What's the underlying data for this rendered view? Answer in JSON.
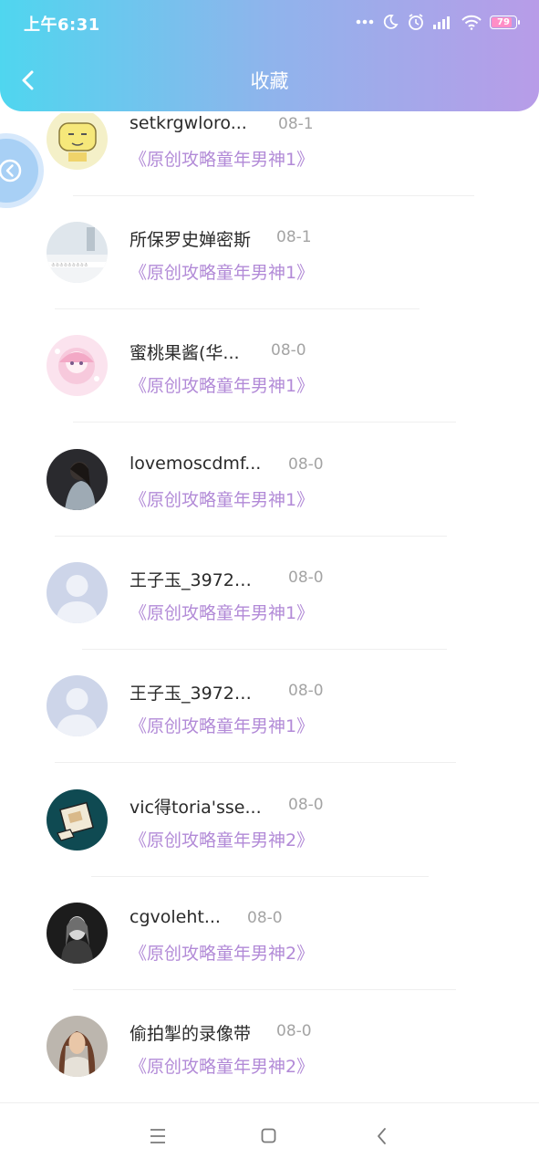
{
  "status_bar": {
    "time": "上午6:31",
    "battery": "79",
    "icons": [
      "more-dots-icon",
      "moon-icon",
      "alarm-icon",
      "signal-icon",
      "wifi-icon",
      "battery-icon"
    ]
  },
  "header": {
    "title": "收藏",
    "back_icon": "chevron-left-icon",
    "gradient_colors": [
      "#4fd6ef",
      "#8fb4ec",
      "#b89ce8"
    ]
  },
  "floating_button": {
    "icon": "chevron-left-circle-icon"
  },
  "colors": {
    "link": "#b28ad7",
    "date": "#a4a4a4",
    "name": "#2a2a2a"
  },
  "items": [
    {
      "name": "setkrgwloro...",
      "date": "08-1",
      "link": "《原创攻略童年男神1》",
      "avatar": "cartoon-face"
    },
    {
      "name": "所保罗史婵密斯",
      "date": "08-1",
      "link": "《原创攻略童年男神1》",
      "avatar": "snow-scene"
    },
    {
      "name": "蜜桃果酱(华...",
      "date": "08-0",
      "link": "《原创攻略童年男神1》",
      "avatar": "anime-girl"
    },
    {
      "name": "lovemoscdmf...",
      "date": "08-0",
      "link": "《原创攻略童年男神1》",
      "avatar": "dark-photo"
    },
    {
      "name": "王子玉_39721...",
      "date": "08-0",
      "link": "《原创攻略童年男神1》",
      "avatar": "default-user"
    },
    {
      "name": "王子玉_39721...",
      "date": "08-0",
      "link": "《原创攻略童年男神1》",
      "avatar": "default-user"
    },
    {
      "name": "vic得toria'sse...",
      "date": "08-0",
      "link": "《原创攻略童年男神2》",
      "avatar": "teal-illustration"
    },
    {
      "name": "cgvoleht...",
      "date": "08-0",
      "link": "《原创攻略童年男神2》",
      "avatar": "bw-portrait"
    },
    {
      "name": "偷拍掣的录像带",
      "date": "08-0",
      "link": "《原创攻略童年男神2》",
      "avatar": "woman-photo"
    }
  ],
  "nav_bar": {
    "icons": [
      "menu-icon",
      "home-square-icon",
      "back-triangle-icon"
    ]
  }
}
